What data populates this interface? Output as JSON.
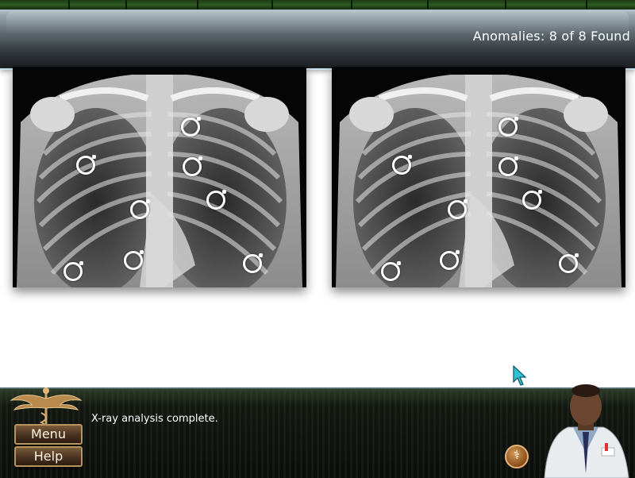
{
  "header": {
    "counter_text": "Anomalies: 8 of 8 Found"
  },
  "panels": {
    "left_label": "x-ray-left",
    "right_label": "x-ray-right",
    "markers_found": 8,
    "markers_total": 8
  },
  "bottom": {
    "message": "X-ray analysis complete.",
    "menu_label": "Menu",
    "help_label": "Help",
    "badge_icon": "caduceus-icon"
  },
  "colors": {
    "header_text": "#ffffff",
    "marker": "#ffffff",
    "button_border": "#b9935e",
    "cursor": "#2ec4d6"
  }
}
